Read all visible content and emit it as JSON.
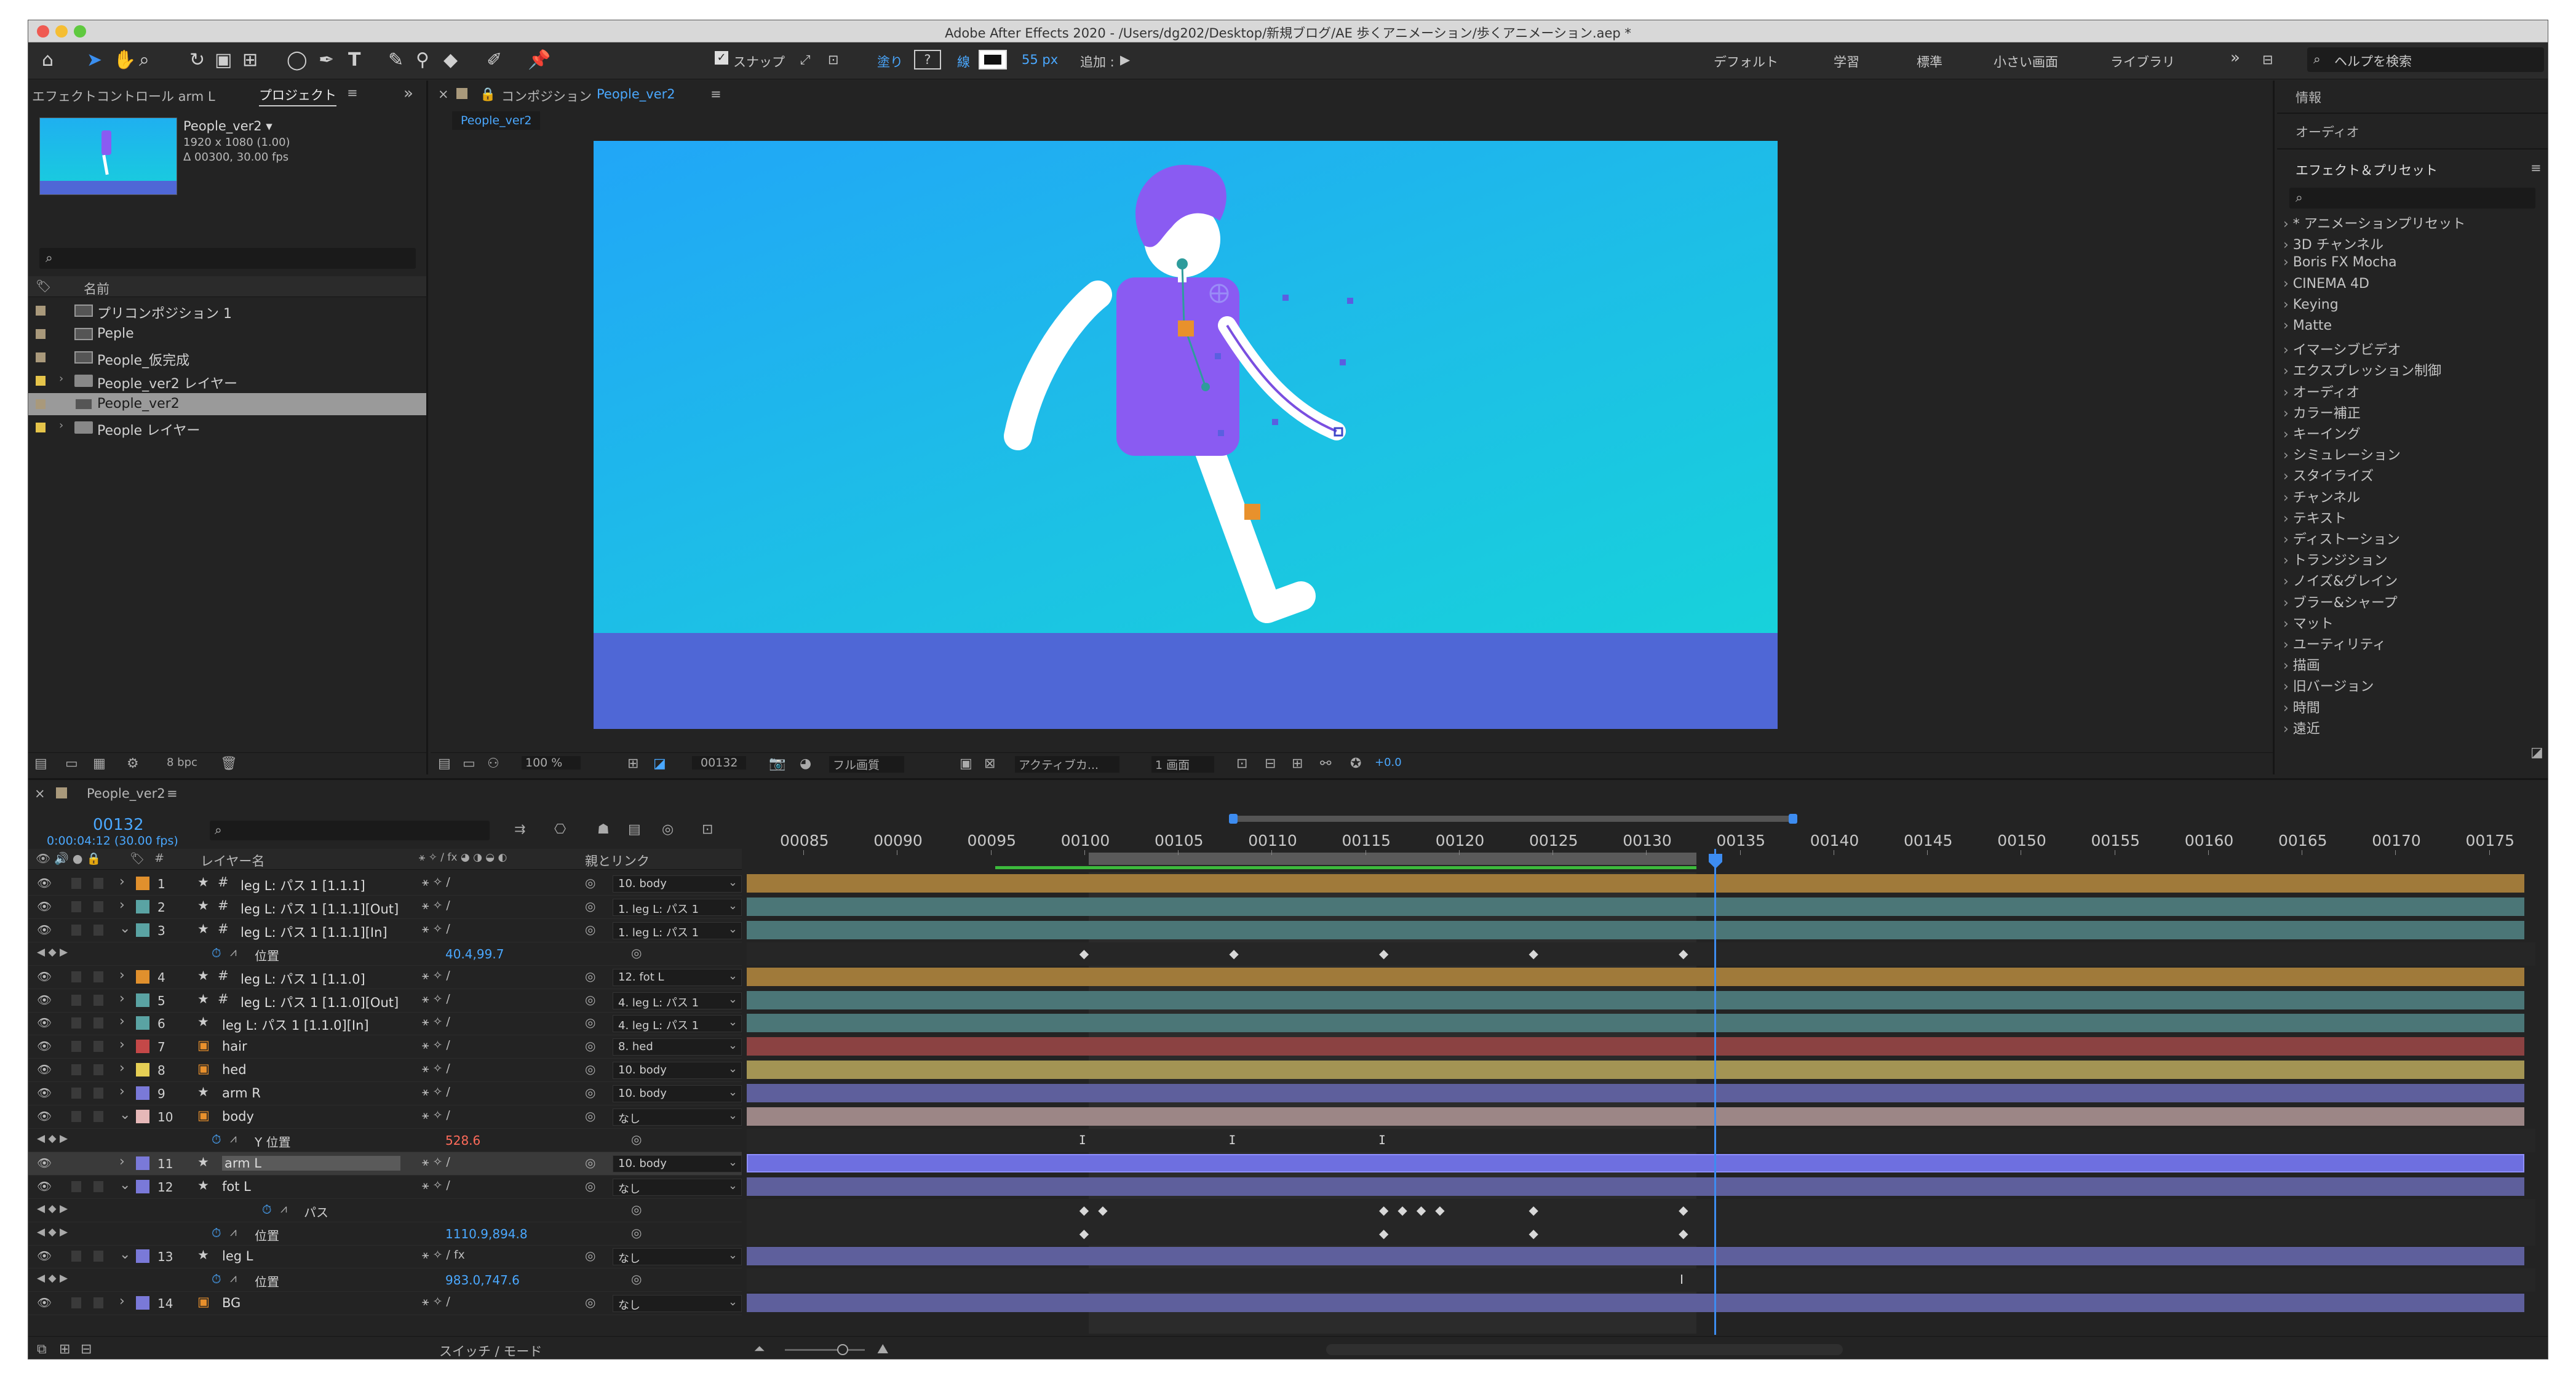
{
  "title": "Adobe After Effects 2020 - /Users/dg202/Desktop/新規ブログ/AE 歩くアニメーション/歩くアニメーション.aep *",
  "toolbar": {
    "snap_label": "スナップ",
    "fill_label": "塗り",
    "fill_value": "?",
    "stroke_label": "線",
    "stroke_px": "55 px",
    "add_label": "追加 :",
    "workspaces": [
      "デフォルト",
      "学習",
      "標準",
      "小さい画面",
      "ライブラリ"
    ],
    "search_placeholder": "ヘルプを検索"
  },
  "project_panel": {
    "tab_effects": "エフェクトコントロール arm L",
    "tab_project": "プロジェクト",
    "comp_name": "People_ver2 ▾",
    "comp_info_1": "1920 x 1080 (1.00)",
    "comp_info_2": "Δ 00300, 30.00 fps",
    "search_placeholder": "",
    "col_name": "名前",
    "items": [
      {
        "name": "プリコンポジション 1",
        "color": "#a9997b",
        "type": "comp"
      },
      {
        "name": "Peple",
        "color": "#a9997b",
        "type": "comp"
      },
      {
        "name": "People_仮完成",
        "color": "#a9997b",
        "type": "comp"
      },
      {
        "name": "People_ver2 レイヤー",
        "color": "#e5c44a",
        "type": "folder"
      },
      {
        "name": "People_ver2",
        "color": "#a9997b",
        "type": "comp"
      },
      {
        "name": "People レイヤー",
        "color": "#e5c44a",
        "type": "folder"
      }
    ],
    "bpc": "8 bpc"
  },
  "comp_panel": {
    "tab_label": "コンポジション",
    "comp_name": "People_ver2",
    "subtab": "People_ver2",
    "zoom": "100 %",
    "frame": "00132",
    "quality": "フル画質",
    "camera": "アクティブカ...",
    "views": "1 画面",
    "exposure": "+0.0"
  },
  "right_panel": {
    "info": "情報",
    "audio": "オーディオ",
    "effects_title": "エフェクト＆プリセット",
    "search_placeholder": "",
    "items": [
      "* アニメーションプリセット",
      "3D チャンネル",
      "Boris FX Mocha",
      "CINEMA 4D",
      "Keying",
      "Matte",
      "イマーシブビデオ",
      "エクスプレッション制御",
      "オーディオ",
      "カラー補正",
      "キーイング",
      "シミュレーション",
      "スタイライズ",
      "チャンネル",
      "テキスト",
      "ディストーション",
      "トランジション",
      "ノイズ&グレイン",
      "ブラー&シャープ",
      "マット",
      "ユーティリティ",
      "描画",
      "旧バージョン",
      "時間",
      "遠近"
    ]
  },
  "timeline": {
    "tab": "People_ver2",
    "timecode": "00132",
    "timecode_sub": "0:00:04:12 (30.00 fps)",
    "col_layer_name": "レイヤー名",
    "col_parent": "親とリンク",
    "ruler": [
      "00085",
      "00090",
      "00095",
      "00100",
      "00105",
      "00110",
      "00115",
      "00120",
      "00125",
      "00130",
      "00135",
      "00140",
      "00145",
      "00150",
      "00155",
      "00160",
      "00165",
      "00170",
      "00175"
    ],
    "switch_mode": "スイッチ / モード",
    "rows": [
      {
        "kind": "layer",
        "num": "1",
        "name": "leg L: パス 1 [1.1.1]",
        "label": "#e0902d",
        "icon": "★",
        "parent": "10. body",
        "bar": "#a07a3a",
        "twirl": "›"
      },
      {
        "kind": "layer",
        "num": "2",
        "name": "leg L: パス 1 [1.1.1][Out]",
        "label": "#5aa3a3",
        "icon": "★",
        "parent": "1. leg L: パス 1",
        "bar": "#4b7677",
        "twirl": "›"
      },
      {
        "kind": "layer",
        "num": "3",
        "name": "leg L: パス 1 [1.1.1][In]",
        "label": "#5aa3a3",
        "icon": "★",
        "parent": "1. leg L: パス 1",
        "bar": "#4b7677",
        "twirl": "⌄"
      },
      {
        "kind": "prop",
        "name": "位置",
        "value": "40.4,99.7",
        "valcolor": "#4aa8ff",
        "keys": [
          100,
          108,
          116,
          124,
          132
        ]
      },
      {
        "kind": "layer",
        "num": "4",
        "name": "leg L: パス 1 [1.1.0]",
        "label": "#e0902d",
        "icon": "★",
        "parent": "12. fot L",
        "bar": "#a07a3a",
        "twirl": "›"
      },
      {
        "kind": "layer",
        "num": "5",
        "name": "leg L: パス 1 [1.1.0][Out]",
        "label": "#5aa3a3",
        "icon": "★",
        "parent": "4. leg L: パス 1",
        "bar": "#4b7677",
        "twirl": "›"
      },
      {
        "kind": "layer",
        "num": "6",
        "name": "leg L: パス 1 [1.1.0][In]",
        "label": "#5aa3a3",
        "icon": "★",
        "parent": "4. leg L: パス 1",
        "bar": "#4b7677",
        "twirl": "›"
      },
      {
        "kind": "layer",
        "num": "7",
        "name": "hair",
        "label": "#c44848",
        "icon": "Ai",
        "parent": "8. hed",
        "bar": "#8b4242",
        "twirl": "›"
      },
      {
        "kind": "layer",
        "num": "8",
        "name": "hed",
        "label": "#e6cf55",
        "icon": "Ai",
        "parent": "10. body",
        "bar": "#a39454",
        "twirl": "›"
      },
      {
        "kind": "layer",
        "num": "9",
        "name": "arm R",
        "label": "#7a79d8",
        "icon": "★",
        "parent": "10. body",
        "bar": "#5e5f9c",
        "twirl": "›"
      },
      {
        "kind": "layer",
        "num": "10",
        "name": "body",
        "label": "#e6b8b8",
        "icon": "Ai",
        "parent": "なし",
        "bar": "#9c8686",
        "twirl": "⌄"
      },
      {
        "kind": "prop",
        "name": "Y 位置",
        "value": "528.6",
        "valcolor": "#ff6b5a",
        "keys": [
          100,
          108,
          116
        ],
        "keyglyph": "ⵊ"
      },
      {
        "kind": "layer",
        "num": "11",
        "name": "arm L",
        "label": "#7a79d8",
        "icon": "★",
        "parent": "10. body",
        "bar": "#6e6fe0",
        "twirl": "›",
        "selected": true
      },
      {
        "kind": "layer",
        "num": "12",
        "name": "fot L",
        "label": "#7a79d8",
        "icon": "★",
        "parent": "なし",
        "bar": "#5e5f9c",
        "twirl": "⌄"
      },
      {
        "kind": "prop",
        "name": "パス",
        "value": "",
        "valcolor": "#4aa8ff",
        "indent": true,
        "keys": [
          100,
          101,
          116,
          117,
          118,
          119,
          124,
          132
        ]
      },
      {
        "kind": "prop",
        "name": "位置",
        "value": "1110.9,894.8",
        "valcolor": "#4aa8ff",
        "keys": [
          100,
          116,
          124,
          132
        ]
      },
      {
        "kind": "layer",
        "num": "13",
        "name": "leg L",
        "label": "#7a79d8",
        "icon": "★",
        "parent": "なし",
        "bar": "#5e5f9c",
        "twirl": "⌄",
        "fx": true
      },
      {
        "kind": "prop",
        "name": "位置",
        "value": "983.0,747.6",
        "valcolor": "#4aa8ff",
        "keys": [],
        "nokf": true
      },
      {
        "kind": "layer",
        "num": "14",
        "name": "BG",
        "label": "#7a79d8",
        "icon": "Ai",
        "parent": "なし",
        "bar": "#5e5f9c",
        "twirl": "›"
      }
    ]
  },
  "colors": {
    "accent": "#2d8ceb",
    "sky_top": "#1eaef5",
    "sky_bottom": "#16d4d8",
    "ground": "#4f67d6",
    "character": "#8a5bf2"
  }
}
